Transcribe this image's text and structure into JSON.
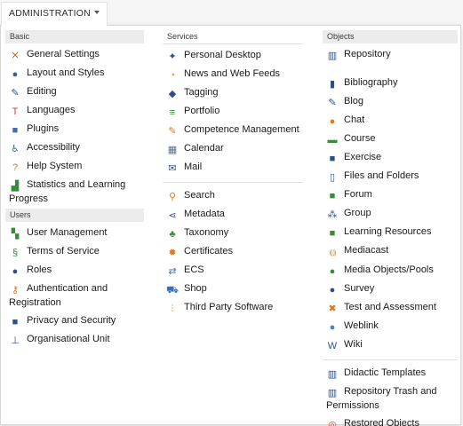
{
  "header": {
    "menu_label": "ADMINISTRATION"
  },
  "columns": [
    {
      "groups": [
        {
          "heading": "Basic",
          "items": [
            {
              "label": "General Settings",
              "icon": "tools-icon",
              "glyph": "✕",
              "color": "#c46c1a"
            },
            {
              "label": "Layout and Styles",
              "icon": "palette-icon",
              "glyph": "●",
              "color": "#3b5b8a"
            },
            {
              "label": "Editing",
              "icon": "pen-icon",
              "glyph": "✎",
              "color": "#2c4f8c"
            },
            {
              "label": "Languages",
              "icon": "languages-icon",
              "glyph": "T",
              "color": "#d53a2a"
            },
            {
              "label": "Plugins",
              "icon": "plugin-icon",
              "glyph": "■",
              "color": "#3a6fb0"
            },
            {
              "label": "Accessibility",
              "icon": "accessibility-icon",
              "glyph": "♿",
              "color": "#3a6fb0"
            },
            {
              "label": "Help System",
              "icon": "help-icon",
              "glyph": "?",
              "color": "#e8761c"
            },
            {
              "label": "Statistics and Learning Progress",
              "icon": "chart-icon",
              "glyph": "▟",
              "color": "#3a8a3a"
            }
          ]
        },
        {
          "heading": "Users",
          "items": [
            {
              "label": "User Management",
              "icon": "users-icon",
              "glyph": "▚",
              "color": "#3a8a3a"
            },
            {
              "label": "Terms of Service",
              "icon": "paragraph-icon",
              "glyph": "§",
              "color": "#2f8a3f"
            },
            {
              "label": "Roles",
              "icon": "roles-icon",
              "glyph": "●",
              "color": "#2c4f8c"
            },
            {
              "label": "Authentication and Registration",
              "icon": "key-icon",
              "glyph": "⚷",
              "color": "#e07a1a"
            },
            {
              "label": "Privacy and Security",
              "icon": "lock-icon",
              "glyph": "■",
              "color": "#2c4f8c"
            },
            {
              "label": "Organisational Unit",
              "icon": "org-unit-icon",
              "glyph": "⊥",
              "color": "#2c4f8c"
            }
          ]
        }
      ]
    },
    {
      "groups": [
        {
          "heading": "Services",
          "items": [
            {
              "label": "Personal Desktop",
              "icon": "desktop-icon",
              "glyph": "✦",
              "color": "#2c4f8c"
            },
            {
              "label": "News and Web Feeds",
              "icon": "rss-icon",
              "glyph": "◔",
              "color": "#e38a1f"
            },
            {
              "label": "Tagging",
              "icon": "tag-icon",
              "glyph": "◆",
              "color": "#2c4f8c"
            },
            {
              "label": "Portfolio",
              "icon": "portfolio-icon",
              "glyph": "≡",
              "color": "#3a8a3a"
            },
            {
              "label": "Competence Management",
              "icon": "competence-icon",
              "glyph": "✎",
              "color": "#e07a1a"
            },
            {
              "label": "Calendar",
              "icon": "calendar-icon",
              "glyph": "▦",
              "color": "#5a6f8a"
            },
            {
              "label": "Mail",
              "icon": "mail-icon",
              "glyph": "✉",
              "color": "#2c4f8c"
            }
          ],
          "separator_after": true
        },
        {
          "heading": "",
          "items": [
            {
              "label": "Search",
              "icon": "search-icon",
              "glyph": "⚲",
              "color": "#e07a1a"
            },
            {
              "label": "Metadata",
              "icon": "metadata-icon",
              "glyph": "⋖",
              "color": "#2c4f8c"
            },
            {
              "label": "Taxonomy",
              "icon": "taxonomy-icon",
              "glyph": "♣",
              "color": "#3a8a3a"
            },
            {
              "label": "Certificates",
              "icon": "certificate-icon",
              "glyph": "✹",
              "color": "#e07a1a"
            },
            {
              "label": "ECS",
              "icon": "ecs-icon",
              "glyph": "⇄",
              "color": "#3a6fb0"
            },
            {
              "label": "Shop",
              "icon": "cart-icon",
              "glyph": "⛟",
              "color": "#3a6fb0"
            },
            {
              "label": "Third Party Software",
              "icon": "sliders-icon",
              "glyph": "⫶",
              "color": "#e07a1a"
            }
          ]
        }
      ]
    },
    {
      "groups": [
        {
          "heading": "Objects",
          "items": [
            {
              "label": "Repository",
              "icon": "repository-icon",
              "glyph": "▥",
              "color": "#2c4f8c"
            }
          ],
          "gap_after": true
        },
        {
          "heading": "",
          "items": [
            {
              "label": "Bibliography",
              "icon": "books-icon",
              "glyph": "▮",
              "color": "#2c4f8c"
            },
            {
              "label": "Blog",
              "icon": "blog-icon",
              "glyph": "✎",
              "color": "#2c4f8c"
            },
            {
              "label": "Chat",
              "icon": "chat-icon",
              "glyph": "●",
              "color": "#e07a1a"
            },
            {
              "label": "Course",
              "icon": "course-icon",
              "glyph": "▬",
              "color": "#3a8a3a"
            },
            {
              "label": "Exercise",
              "icon": "exercise-icon",
              "glyph": "■",
              "color": "#2c4f8c"
            },
            {
              "label": "Files and Folders",
              "icon": "file-icon",
              "glyph": "▯",
              "color": "#2c4f8c"
            },
            {
              "label": "Forum",
              "icon": "forum-icon",
              "glyph": "■",
              "color": "#3a8a3a"
            },
            {
              "label": "Group",
              "icon": "group-icon",
              "glyph": "⁂",
              "color": "#2c4f8c"
            },
            {
              "label": "Learning Resources",
              "icon": "learning-resources-icon",
              "glyph": "■",
              "color": "#3a8a3a"
            },
            {
              "label": "Mediacast",
              "icon": "mediacast-icon",
              "glyph": "((·))",
              "color": "#e07a1a"
            },
            {
              "label": "Media Objects/Pools",
              "icon": "media-pool-icon",
              "glyph": "●",
              "color": "#3a8a3a"
            },
            {
              "label": "Survey",
              "icon": "survey-icon",
              "glyph": "●",
              "color": "#2c4f8c"
            },
            {
              "label": "Test and Assessment",
              "icon": "test-icon",
              "glyph": "✖",
              "color": "#e07a1a"
            },
            {
              "label": "Weblink",
              "icon": "weblink-icon",
              "glyph": "●",
              "color": "#3a8ac8"
            },
            {
              "label": "Wiki",
              "icon": "wiki-icon",
              "glyph": "W",
              "color": "#2c4f8c"
            }
          ],
          "separator_after": true
        },
        {
          "heading": "",
          "items": [
            {
              "label": "Didactic Templates",
              "icon": "didactic-template-icon",
              "glyph": "▥",
              "color": "#2c4f8c"
            },
            {
              "label": "Repository Trash and Permissions",
              "icon": "trash-permissions-icon",
              "glyph": "▥",
              "color": "#2c4f8c"
            },
            {
              "label": "Restored Objects",
              "icon": "lifebuoy-icon",
              "glyph": "◎",
              "color": "#d53a2a"
            }
          ]
        }
      ]
    }
  ]
}
